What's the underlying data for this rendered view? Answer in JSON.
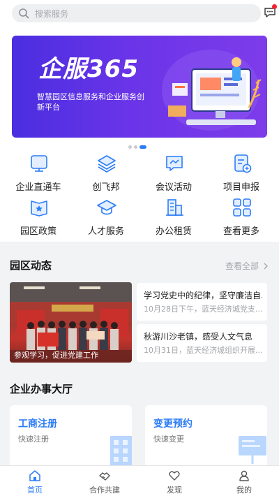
{
  "search": {
    "placeholder": "搜索服务"
  },
  "banner": {
    "logo": "企服365",
    "subtitle": "智慧园区信息服务和企业服务创新平台"
  },
  "services": [
    {
      "label": "企业直通车",
      "icon": "monitor-icon"
    },
    {
      "label": "创飞邦",
      "icon": "layers-icon"
    },
    {
      "label": "会议活动",
      "icon": "chat-chart-icon"
    },
    {
      "label": "项目申报",
      "icon": "document-add-icon"
    },
    {
      "label": "园区政策",
      "icon": "policy-book-icon"
    },
    {
      "label": "人才服务",
      "icon": "graduation-cap-icon"
    },
    {
      "label": "办公租赁",
      "icon": "building-icon"
    },
    {
      "label": "查看更多",
      "icon": "grid-more-icon"
    }
  ],
  "park_news": {
    "title": "园区动态",
    "see_all": "查看全部",
    "photo_caption": "参观学习，促进党建工作",
    "items": [
      {
        "title": "学习党史中的纪律，坚守廉洁自...",
        "meta": "10月28日下午，蓝天经济城党支..."
      },
      {
        "title": "秋游川沙老镇，感受人文气息",
        "meta": "10月31日，蓝天经济城组织开展..."
      }
    ]
  },
  "hall": {
    "title": "企业办事大厅",
    "cards": [
      {
        "title": "工商注册",
        "subtitle": "快速注册"
      },
      {
        "title": "变更预约",
        "subtitle": "快速变更"
      }
    ]
  },
  "tabbar": [
    {
      "label": "首页",
      "icon": "home-icon"
    },
    {
      "label": "合作共建",
      "icon": "handshake-icon"
    },
    {
      "label": "发现",
      "icon": "heart-icon"
    },
    {
      "label": "我的",
      "icon": "user-icon"
    }
  ],
  "colors": {
    "accent": "#2c7cf6",
    "banner": "#5b31e4",
    "badge": "#f5222d"
  }
}
